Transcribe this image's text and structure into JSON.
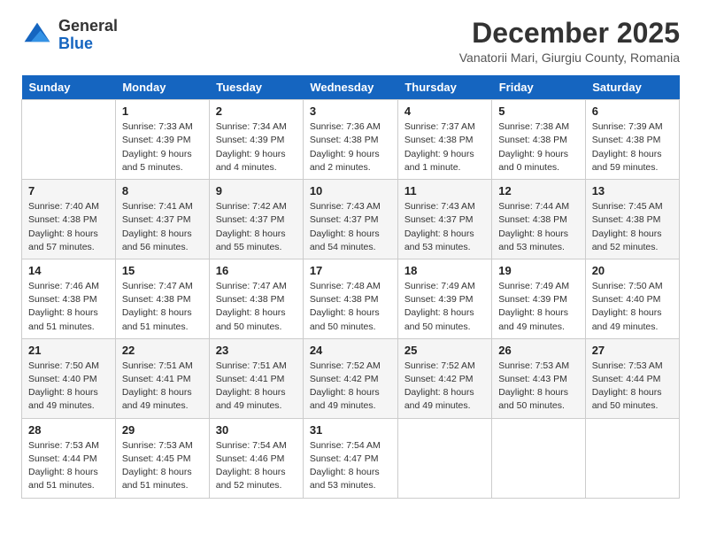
{
  "header": {
    "logo_line1": "General",
    "logo_line2": "Blue",
    "month_title": "December 2025",
    "subtitle": "Vanatorii Mari, Giurgiu County, Romania"
  },
  "days_of_week": [
    "Sunday",
    "Monday",
    "Tuesday",
    "Wednesday",
    "Thursday",
    "Friday",
    "Saturday"
  ],
  "weeks": [
    [
      {
        "day": "",
        "info": ""
      },
      {
        "day": "1",
        "info": "Sunrise: 7:33 AM\nSunset: 4:39 PM\nDaylight: 9 hours\nand 5 minutes."
      },
      {
        "day": "2",
        "info": "Sunrise: 7:34 AM\nSunset: 4:39 PM\nDaylight: 9 hours\nand 4 minutes."
      },
      {
        "day": "3",
        "info": "Sunrise: 7:36 AM\nSunset: 4:38 PM\nDaylight: 9 hours\nand 2 minutes."
      },
      {
        "day": "4",
        "info": "Sunrise: 7:37 AM\nSunset: 4:38 PM\nDaylight: 9 hours\nand 1 minute."
      },
      {
        "day": "5",
        "info": "Sunrise: 7:38 AM\nSunset: 4:38 PM\nDaylight: 9 hours\nand 0 minutes."
      },
      {
        "day": "6",
        "info": "Sunrise: 7:39 AM\nSunset: 4:38 PM\nDaylight: 8 hours\nand 59 minutes."
      }
    ],
    [
      {
        "day": "7",
        "info": "Sunrise: 7:40 AM\nSunset: 4:38 PM\nDaylight: 8 hours\nand 57 minutes."
      },
      {
        "day": "8",
        "info": "Sunrise: 7:41 AM\nSunset: 4:37 PM\nDaylight: 8 hours\nand 56 minutes."
      },
      {
        "day": "9",
        "info": "Sunrise: 7:42 AM\nSunset: 4:37 PM\nDaylight: 8 hours\nand 55 minutes."
      },
      {
        "day": "10",
        "info": "Sunrise: 7:43 AM\nSunset: 4:37 PM\nDaylight: 8 hours\nand 54 minutes."
      },
      {
        "day": "11",
        "info": "Sunrise: 7:43 AM\nSunset: 4:37 PM\nDaylight: 8 hours\nand 53 minutes."
      },
      {
        "day": "12",
        "info": "Sunrise: 7:44 AM\nSunset: 4:38 PM\nDaylight: 8 hours\nand 53 minutes."
      },
      {
        "day": "13",
        "info": "Sunrise: 7:45 AM\nSunset: 4:38 PM\nDaylight: 8 hours\nand 52 minutes."
      }
    ],
    [
      {
        "day": "14",
        "info": "Sunrise: 7:46 AM\nSunset: 4:38 PM\nDaylight: 8 hours\nand 51 minutes."
      },
      {
        "day": "15",
        "info": "Sunrise: 7:47 AM\nSunset: 4:38 PM\nDaylight: 8 hours\nand 51 minutes."
      },
      {
        "day": "16",
        "info": "Sunrise: 7:47 AM\nSunset: 4:38 PM\nDaylight: 8 hours\nand 50 minutes."
      },
      {
        "day": "17",
        "info": "Sunrise: 7:48 AM\nSunset: 4:38 PM\nDaylight: 8 hours\nand 50 minutes."
      },
      {
        "day": "18",
        "info": "Sunrise: 7:49 AM\nSunset: 4:39 PM\nDaylight: 8 hours\nand 50 minutes."
      },
      {
        "day": "19",
        "info": "Sunrise: 7:49 AM\nSunset: 4:39 PM\nDaylight: 8 hours\nand 49 minutes."
      },
      {
        "day": "20",
        "info": "Sunrise: 7:50 AM\nSunset: 4:40 PM\nDaylight: 8 hours\nand 49 minutes."
      }
    ],
    [
      {
        "day": "21",
        "info": "Sunrise: 7:50 AM\nSunset: 4:40 PM\nDaylight: 8 hours\nand 49 minutes."
      },
      {
        "day": "22",
        "info": "Sunrise: 7:51 AM\nSunset: 4:41 PM\nDaylight: 8 hours\nand 49 minutes."
      },
      {
        "day": "23",
        "info": "Sunrise: 7:51 AM\nSunset: 4:41 PM\nDaylight: 8 hours\nand 49 minutes."
      },
      {
        "day": "24",
        "info": "Sunrise: 7:52 AM\nSunset: 4:42 PM\nDaylight: 8 hours\nand 49 minutes."
      },
      {
        "day": "25",
        "info": "Sunrise: 7:52 AM\nSunset: 4:42 PM\nDaylight: 8 hours\nand 49 minutes."
      },
      {
        "day": "26",
        "info": "Sunrise: 7:53 AM\nSunset: 4:43 PM\nDaylight: 8 hours\nand 50 minutes."
      },
      {
        "day": "27",
        "info": "Sunrise: 7:53 AM\nSunset: 4:44 PM\nDaylight: 8 hours\nand 50 minutes."
      }
    ],
    [
      {
        "day": "28",
        "info": "Sunrise: 7:53 AM\nSunset: 4:44 PM\nDaylight: 8 hours\nand 51 minutes."
      },
      {
        "day": "29",
        "info": "Sunrise: 7:53 AM\nSunset: 4:45 PM\nDaylight: 8 hours\nand 51 minutes."
      },
      {
        "day": "30",
        "info": "Sunrise: 7:54 AM\nSunset: 4:46 PM\nDaylight: 8 hours\nand 52 minutes."
      },
      {
        "day": "31",
        "info": "Sunrise: 7:54 AM\nSunset: 4:47 PM\nDaylight: 8 hours\nand 53 minutes."
      },
      {
        "day": "",
        "info": ""
      },
      {
        "day": "",
        "info": ""
      },
      {
        "day": "",
        "info": ""
      }
    ]
  ]
}
